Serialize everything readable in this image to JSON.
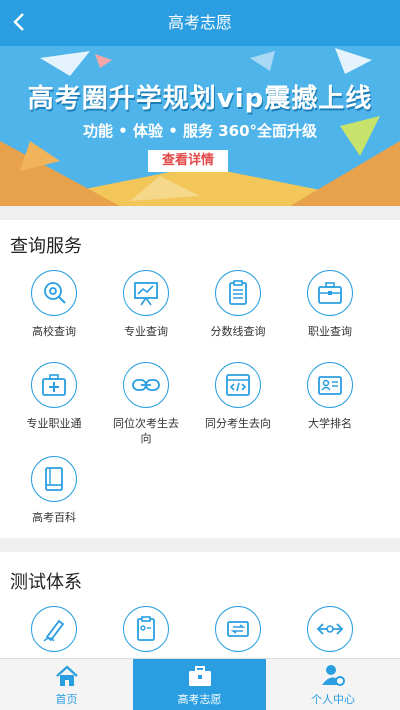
{
  "header": {
    "title": "高考志愿",
    "back_icon": "chevron-left-icon"
  },
  "banner": {
    "headline": "高考圈升学规划vip震撼上线",
    "subline": "功能 • 体验 • 服务  360°全面升级",
    "cta": "查看详情"
  },
  "query_services": {
    "title": "查询服务",
    "items": [
      {
        "label": "高校查询",
        "icon": "university-search-icon"
      },
      {
        "label": "专业查询",
        "icon": "chart-board-icon"
      },
      {
        "label": "分数线查询",
        "icon": "clipboard-icon"
      },
      {
        "label": "职业查询",
        "icon": "briefcase-icon"
      },
      {
        "label": "专业职业通",
        "icon": "medical-kit-icon"
      },
      {
        "label": "同位次考生去向",
        "icon": "link-icon"
      },
      {
        "label": "同分考生去向",
        "icon": "code-window-icon"
      },
      {
        "label": "大学排名",
        "icon": "id-card-icon"
      },
      {
        "label": "高考百科",
        "icon": "book-icon"
      }
    ]
  },
  "test_system": {
    "title": "测试体系",
    "items": [
      {
        "icon": "pen-icon"
      },
      {
        "icon": "report-icon"
      },
      {
        "icon": "swap-icon"
      },
      {
        "icon": "compare-arrows-icon"
      }
    ]
  },
  "tabbar": {
    "items": [
      {
        "label": "首页",
        "icon": "home-icon",
        "active": false
      },
      {
        "label": "高考志愿",
        "icon": "briefcase-icon",
        "active": true
      },
      {
        "label": "个人中心",
        "icon": "user-settings-icon",
        "active": false
      }
    ]
  },
  "colors": {
    "primary": "#2a9ee0",
    "cta_text": "#e24a4a"
  }
}
